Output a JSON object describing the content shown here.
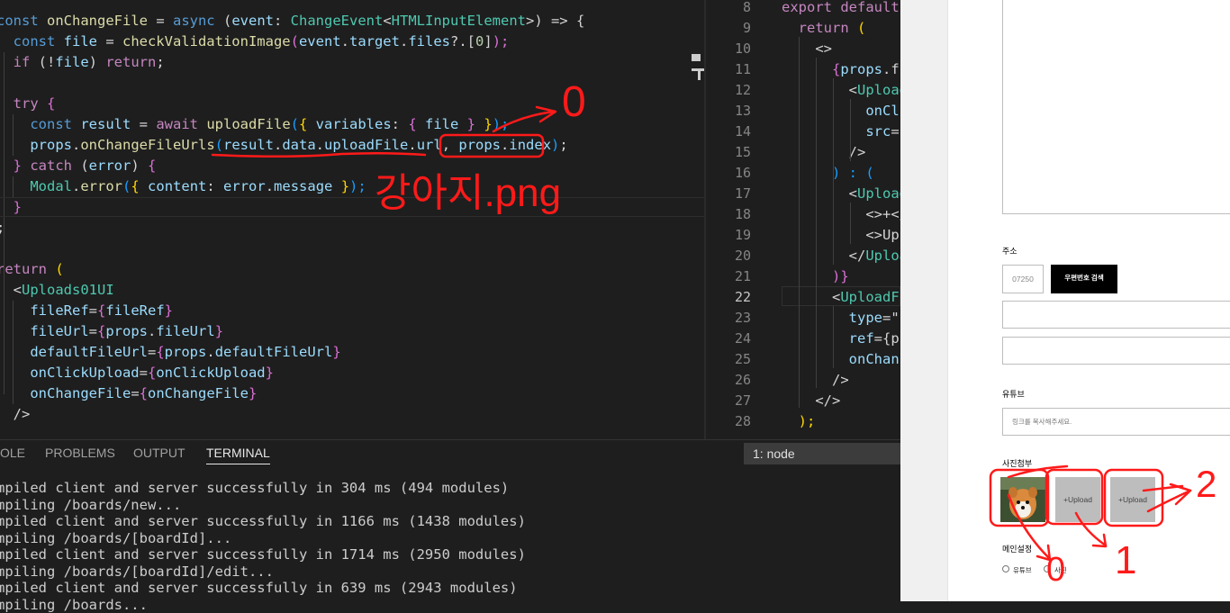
{
  "editor_left": {
    "lines": [
      [
        [
          "const ",
          "c-kw2"
        ],
        [
          "onChangeFile",
          "c-fn"
        ],
        [
          " = ",
          "c-plain"
        ],
        [
          "async",
          "c-kw2"
        ],
        [
          " (",
          "c-plain"
        ],
        [
          "event",
          "c-var"
        ],
        [
          ": ",
          "c-plain"
        ],
        [
          "ChangeEvent",
          "c-type"
        ],
        [
          "<",
          "c-plain"
        ],
        [
          "HTMLInputElement",
          "c-type"
        ],
        [
          ">) => {",
          "c-plain"
        ]
      ],
      [
        [
          "  const ",
          "c-kw2"
        ],
        [
          "file",
          "c-var"
        ],
        [
          " = ",
          "c-plain"
        ],
        [
          "checkValidationImage",
          "c-fn"
        ],
        [
          "(",
          "c-br2"
        ],
        [
          "event",
          "c-var"
        ],
        [
          ".",
          "c-plain"
        ],
        [
          "target",
          "c-var"
        ],
        [
          ".",
          "c-plain"
        ],
        [
          "files",
          "c-var"
        ],
        [
          "?.[",
          "c-plain"
        ],
        [
          "0",
          "c-num"
        ],
        [
          "]",
          "c-plain"
        ],
        [
          ");",
          "c-br2"
        ]
      ],
      [
        [
          "  if ",
          "c-kw"
        ],
        [
          "(!",
          "c-plain"
        ],
        [
          "file",
          "c-var"
        ],
        [
          ") ",
          "c-plain"
        ],
        [
          "return",
          "c-kw"
        ],
        [
          ";",
          "c-plain"
        ]
      ],
      [],
      [
        [
          "  try ",
          "c-kw"
        ],
        [
          "{",
          "c-br2"
        ]
      ],
      [
        [
          "    const ",
          "c-kw2"
        ],
        [
          "result",
          "c-var"
        ],
        [
          " = ",
          "c-plain"
        ],
        [
          "await ",
          "c-kw"
        ],
        [
          "uploadFile",
          "c-fn"
        ],
        [
          "(",
          "c-br3"
        ],
        [
          "{ ",
          "c-br1"
        ],
        [
          "variables",
          "c-var"
        ],
        [
          ": ",
          "c-plain"
        ],
        [
          "{ ",
          "c-br2"
        ],
        [
          "file",
          "c-var"
        ],
        [
          " }",
          "c-br2"
        ],
        [
          " }",
          "c-br1"
        ],
        [
          ");",
          "c-br3"
        ]
      ],
      [
        [
          "    props",
          "c-var"
        ],
        [
          ".",
          "c-plain"
        ],
        [
          "onChangeFileUrls",
          "c-fn"
        ],
        [
          "(",
          "c-br3"
        ],
        [
          "result",
          "c-var"
        ],
        [
          ".",
          "c-plain"
        ],
        [
          "data",
          "c-var"
        ],
        [
          ".",
          "c-plain"
        ],
        [
          "uploadFile",
          "c-var"
        ],
        [
          ".",
          "c-plain"
        ],
        [
          "url",
          "c-var"
        ],
        [
          ", ",
          "c-plain"
        ],
        [
          "props",
          "c-var"
        ],
        [
          ".",
          "c-plain"
        ],
        [
          "index",
          "c-var"
        ],
        [
          ")",
          "c-br3"
        ],
        [
          ";",
          "c-plain"
        ]
      ],
      [
        [
          "  } ",
          "c-br2"
        ],
        [
          "catch ",
          "c-kw"
        ],
        [
          "(",
          "c-plain"
        ],
        [
          "error",
          "c-var"
        ],
        [
          ") ",
          "c-plain"
        ],
        [
          "{",
          "c-br2"
        ]
      ],
      [
        [
          "    Modal",
          "c-type"
        ],
        [
          ".",
          "c-plain"
        ],
        [
          "error",
          "c-fn"
        ],
        [
          "(",
          "c-br3"
        ],
        [
          "{ ",
          "c-br1"
        ],
        [
          "content",
          "c-var"
        ],
        [
          ": ",
          "c-plain"
        ],
        [
          "error",
          "c-var"
        ],
        [
          ".",
          "c-plain"
        ],
        [
          "message",
          "c-var"
        ],
        [
          " }",
          "c-br1"
        ],
        [
          ");",
          "c-br3"
        ]
      ],
      [
        [
          "  }",
          "c-br2"
        ]
      ],
      [
        [
          ";",
          "c-plain"
        ]
      ],
      [],
      [
        [
          "return ",
          "c-kw"
        ],
        [
          "(",
          "c-br1"
        ]
      ],
      [
        [
          "  <",
          "c-plain"
        ],
        [
          "Uploads01UI",
          "c-tag"
        ]
      ],
      [
        [
          "    fileRef",
          "c-var"
        ],
        [
          "=",
          "c-plain"
        ],
        [
          "{",
          "c-br2"
        ],
        [
          "fileRef",
          "c-var"
        ],
        [
          "}",
          "c-br2"
        ]
      ],
      [
        [
          "    fileUrl",
          "c-var"
        ],
        [
          "=",
          "c-plain"
        ],
        [
          "{",
          "c-br2"
        ],
        [
          "props",
          "c-var"
        ],
        [
          ".",
          "c-plain"
        ],
        [
          "fileUrl",
          "c-var"
        ],
        [
          "}",
          "c-br2"
        ]
      ],
      [
        [
          "    defaultFileUrl",
          "c-var"
        ],
        [
          "=",
          "c-plain"
        ],
        [
          "{",
          "c-br2"
        ],
        [
          "props",
          "c-var"
        ],
        [
          ".",
          "c-plain"
        ],
        [
          "defaultFileUrl",
          "c-var"
        ],
        [
          "}",
          "c-br2"
        ]
      ],
      [
        [
          "    onClickUpload",
          "c-var"
        ],
        [
          "=",
          "c-plain"
        ],
        [
          "{",
          "c-br2"
        ],
        [
          "onClickUpload",
          "c-var"
        ],
        [
          "}",
          "c-br2"
        ]
      ],
      [
        [
          "    onChangeFile",
          "c-var"
        ],
        [
          "=",
          "c-plain"
        ],
        [
          "{",
          "c-br2"
        ],
        [
          "onChangeFile",
          "c-var"
        ],
        [
          "}",
          "c-br2"
        ]
      ],
      [
        [
          "  />",
          "c-plain"
        ]
      ]
    ]
  },
  "editor_right": {
    "line_numbers": [
      "8",
      "9",
      "10",
      "11",
      "12",
      "13",
      "14",
      "15",
      "16",
      "17",
      "18",
      "19",
      "20",
      "21",
      "22",
      "23",
      "24",
      "25",
      "26",
      "27",
      "28"
    ],
    "active_line": "22",
    "lines": [
      [
        [
          "export ",
          "c-kw"
        ],
        [
          "default",
          "c-kw"
        ]
      ],
      [
        [
          "  return ",
          "c-kw"
        ],
        [
          "(",
          "c-br1"
        ]
      ],
      [
        [
          "    <>",
          "c-plain"
        ]
      ],
      [
        [
          "      {",
          "c-br2"
        ],
        [
          "props",
          "c-var"
        ],
        [
          ".fi",
          "c-plain"
        ]
      ],
      [
        [
          "        <",
          "c-plain"
        ],
        [
          "Upload",
          "c-tag"
        ]
      ],
      [
        [
          "          onCl",
          "c-var"
        ]
      ],
      [
        [
          "          src",
          "c-var"
        ],
        [
          "=",
          "c-plain"
        ]
      ],
      [
        [
          "        />",
          "c-plain"
        ]
      ],
      [
        [
          "      ) : (",
          "c-br3"
        ]
      ],
      [
        [
          "        <",
          "c-plain"
        ],
        [
          "Upload",
          "c-tag"
        ]
      ],
      [
        [
          "          <>+</",
          "c-plain"
        ]
      ],
      [
        [
          "          <>",
          "c-plain"
        ],
        [
          "Up",
          "c-plain"
        ]
      ],
      [
        [
          "        </",
          "c-plain"
        ],
        [
          "Uploa",
          "c-tag"
        ]
      ],
      [
        [
          "      )}",
          "c-br2"
        ]
      ],
      [
        [
          "      <",
          "c-plain"
        ],
        [
          "UploadF",
          "c-tag"
        ]
      ],
      [
        [
          "        type",
          "c-var"
        ],
        [
          "=\"",
          "c-plain"
        ]
      ],
      [
        [
          "        ref",
          "c-var"
        ],
        [
          "={p",
          "c-plain"
        ]
      ],
      [
        [
          "        onChan",
          "c-var"
        ]
      ],
      [
        [
          "      />",
          "c-plain"
        ]
      ],
      [
        [
          "    </>",
          "c-plain"
        ]
      ],
      [
        [
          "  );",
          "c-br1"
        ]
      ]
    ]
  },
  "panel": {
    "tabs": [
      "OLE",
      "PROBLEMS",
      "OUTPUT",
      "TERMINAL"
    ],
    "active_tab": "TERMINAL",
    "terminal_select": "1: node",
    "terminal_lines": [
      "mpiled client and server successfully in 304 ms (494 modules)",
      "mpiling /boards/new...",
      "mpiled client and server successfully in 1166 ms (1438 modules)",
      "mpiling /boards/[boardId]...",
      "mpiled client and server successfully in 1714 ms (2950 modules)",
      "mpiling /boards/[boardId]/edit...",
      "mpiled client and server successfully in 639 ms (2943 modules)",
      "mpiling /boards..."
    ]
  },
  "browser": {
    "address_label": "주소",
    "zipcode": "07250",
    "zip_button": "우편번호 검색",
    "youtube_label": "유튜브",
    "youtube_placeholder": "링크를 복사해주세요.",
    "photo_label": "사진첨부",
    "upload_labels": [
      "+Upload",
      "+Upload"
    ],
    "main_setting_label": "메인설정",
    "radio_options": [
      "유튜브",
      "사진"
    ]
  },
  "annotations": {
    "top_zero": "0",
    "filename": "강아지.png",
    "label_two": "2",
    "label_one": "1",
    "label_zero": "0",
    "color": "#ff1a1a"
  }
}
